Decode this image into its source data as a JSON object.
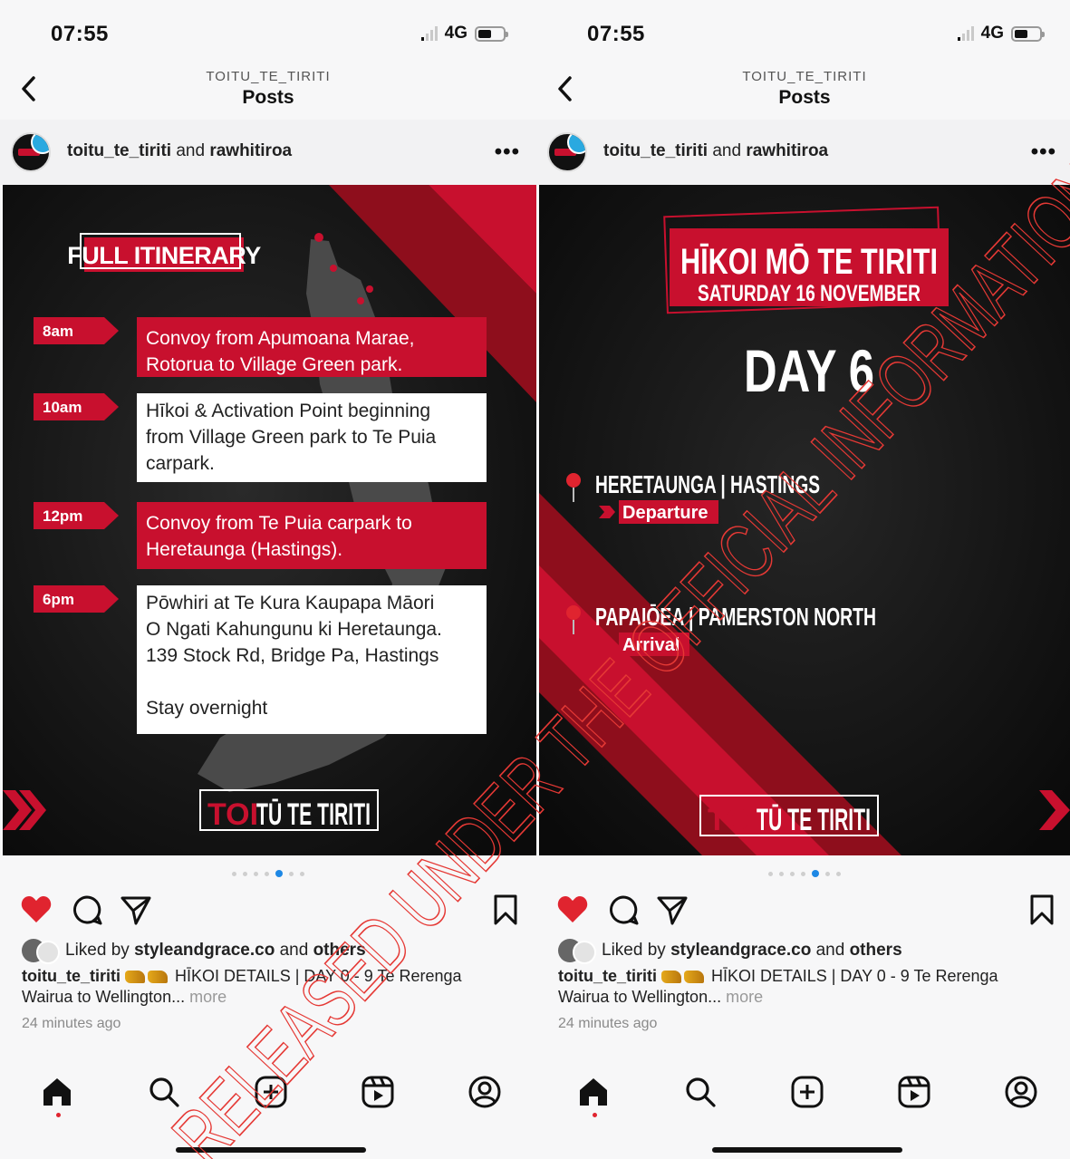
{
  "status_bar": {
    "time": "07:55",
    "network": "4G"
  },
  "header": {
    "account": "TOITU_TE_TIRITI",
    "title": "Posts"
  },
  "post": {
    "user1": "toitu_te_tiriti",
    "joiner": "and",
    "user2": "rawhitiroa",
    "more": "•••"
  },
  "likes": {
    "prefix": "Liked by",
    "user": "styleandgrace.co",
    "joiner": "and",
    "others": "others"
  },
  "caption": {
    "user": "toitu_te_tiriti",
    "text": "HĪKOI DETAILS | DAY 0 - 9 Te Rerenga Wairua to Wellington...",
    "more": "more"
  },
  "timestamp": "24 minutes ago",
  "itinerary": {
    "badge": "FULL ITINERARY",
    "items": [
      {
        "time": "8am",
        "text": [
          "Convoy from Apumoana Marae,",
          "Rotorua to Village Green park."
        ]
      },
      {
        "time": "10am",
        "text": [
          "Hīkoi & Activation Point beginning",
          "from Village Green park to Te Puia",
          "carpark."
        ]
      },
      {
        "time": "12pm",
        "text": [
          "Convoy from Te Puia carpark to",
          "Heretaunga (Hastings)."
        ]
      },
      {
        "time": "6pm",
        "text": [
          "Pōwhiri at Te Kura Kaupapa Māori",
          "O Ngati Kahungunu ki Heretaunga.",
          "139 Stock Rd, Bridge Pa, Hastings",
          "",
          "Stay overnight"
        ]
      }
    ]
  },
  "day_card": {
    "title": "HĪKOI MŌ TE TIRITI",
    "date": "SATURDAY 16 NOVEMBER",
    "day": "DAY 6",
    "stops": [
      {
        "place": "HERETAUNGA | HASTINGS",
        "tag": "Departure"
      },
      {
        "place": "PAPAIŌEA | PAMERSTON NORTH",
        "tag": "Arrival"
      }
    ]
  },
  "logo": {
    "text_red": "TOI",
    "text_white": "TŪ TE TIRITI"
  },
  "watermark": "RELEASED UNDER THE OFFICIAL INFORMATION ACT",
  "colors": {
    "brand_red": "#c8102e",
    "like_red": "#e0242f",
    "active_dot": "#1e88e5",
    "panel_bg": "#141414"
  },
  "icons": [
    "back-icon",
    "more-icon",
    "heart-icon",
    "comment-icon",
    "share-icon",
    "bookmark-icon",
    "home-icon",
    "search-icon",
    "create-icon",
    "reels-icon",
    "profile-icon",
    "pin-icon",
    "chevron-icon"
  ]
}
